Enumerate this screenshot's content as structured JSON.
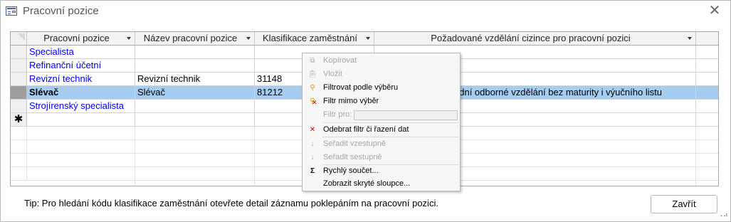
{
  "window": {
    "title": "Pracovní pozice"
  },
  "grid": {
    "headers": [
      "Pracovní pozice",
      "Název pracovní pozice",
      "Klasifikace zaměstnání",
      "Požadované vzdělání cizince pro pracovní pozici"
    ],
    "rows": [
      {
        "pozice": "Specialista",
        "nazev": "",
        "klasifikace": "",
        "vzdelani": ""
      },
      {
        "pozice": "Refinanční účetní",
        "nazev": "",
        "klasifikace": "",
        "vzdelani": ""
      },
      {
        "pozice": "Revizní technik",
        "nazev": "Revizní technik",
        "klasifikace": "31148",
        "vzdelani": ""
      },
      {
        "pozice": "Slévač",
        "nazev": "Slévač",
        "klasifikace": "81212",
        "vzdelani": "ední odborné vzdělání bez maturity i výučního listu"
      },
      {
        "pozice": "Strojírenský specialista",
        "nazev": "",
        "klasifikace": "",
        "vzdelani": ""
      }
    ],
    "new_row_marker": "✱"
  },
  "context_menu": {
    "items": [
      {
        "label": "Kopírovat",
        "icon": "copy-icon",
        "enabled": false
      },
      {
        "label": "Vložit",
        "icon": "paste-icon",
        "enabled": false
      },
      {
        "label": "Filtrovat podle výběru",
        "icon": "filter-by-selection-icon",
        "enabled": true
      },
      {
        "label": "Filtr mimo výběr",
        "icon": "filter-excluding-selection-icon",
        "enabled": true
      },
      {
        "label": "Filtr pro:",
        "icon": "",
        "enabled": false
      },
      {
        "label": "Odebrat filtr či řazení dat",
        "icon": "remove-filter-icon",
        "enabled": true
      },
      {
        "label": "Seřadit vzestupně",
        "icon": "sort-ascending-icon",
        "enabled": false
      },
      {
        "label": "Seřadit sestupně",
        "icon": "sort-descending-icon",
        "enabled": false
      },
      {
        "label": "Rychlý součet...",
        "icon": "quick-sum-icon",
        "enabled": true
      },
      {
        "label": "Zobrazit skryté sloupce...",
        "icon": "",
        "enabled": true
      }
    ]
  },
  "footer": {
    "tip": "Tip: Pro hledání kódu klasifikace zaměstnání otevřete detail záznamu poklepáním na pracovní pozici.",
    "close_label": "Zavřít"
  },
  "colors": {
    "selected_row": "#a6cdf0",
    "link_text": "#0000ee"
  }
}
